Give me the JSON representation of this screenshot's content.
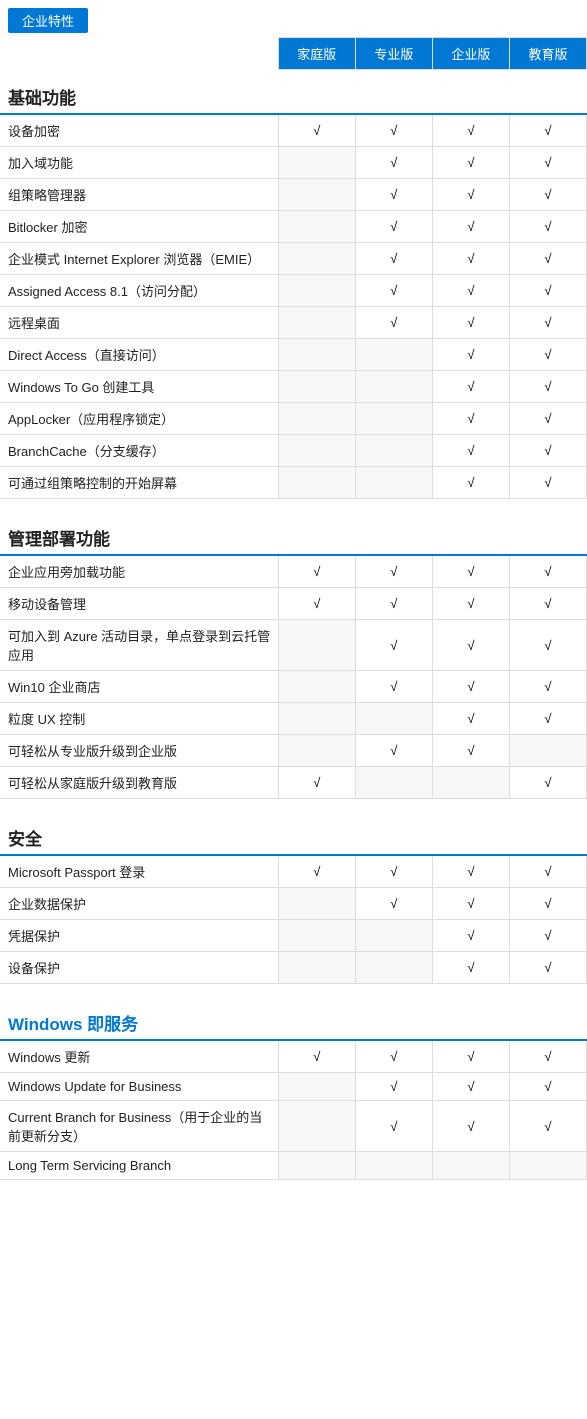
{
  "badge": "企业特性",
  "columns": [
    "家庭版",
    "专业版",
    "企业版",
    "教育版"
  ],
  "sections": [
    {
      "title": "基础功能",
      "blue": false,
      "rows": [
        {
          "name": "设备加密",
          "checks": [
            true,
            true,
            true,
            true
          ]
        },
        {
          "name": "加入域功能",
          "checks": [
            false,
            true,
            true,
            true
          ]
        },
        {
          "name": "组策略管理器",
          "checks": [
            false,
            true,
            true,
            true
          ]
        },
        {
          "name": "Bitlocker 加密",
          "checks": [
            false,
            true,
            true,
            true
          ]
        },
        {
          "name": "企业模式 Internet Explorer 浏览器（EMIE）",
          "checks": [
            false,
            true,
            true,
            true
          ]
        },
        {
          "name": "Assigned Access 8.1（访问分配）",
          "checks": [
            false,
            true,
            true,
            true
          ]
        },
        {
          "name": "远程桌面",
          "checks": [
            false,
            true,
            true,
            true
          ]
        },
        {
          "name": "Direct Access（直接访问）",
          "checks": [
            false,
            false,
            true,
            true
          ]
        },
        {
          "name": "Windows To Go 创建工具",
          "checks": [
            false,
            false,
            true,
            true
          ]
        },
        {
          "name": "AppLocker（应用程序锁定）",
          "checks": [
            false,
            false,
            true,
            true
          ]
        },
        {
          "name": "BranchCache（分支缓存）",
          "checks": [
            false,
            false,
            true,
            true
          ]
        },
        {
          "name": "可通过组策略控制的开始屏幕",
          "checks": [
            false,
            false,
            true,
            true
          ]
        }
      ]
    },
    {
      "title": "管理部署功能",
      "blue": false,
      "rows": [
        {
          "name": "企业应用旁加载功能",
          "checks": [
            true,
            true,
            true,
            true
          ]
        },
        {
          "name": "移动设备管理",
          "checks": [
            true,
            true,
            true,
            true
          ]
        },
        {
          "name": "可加入到 Azure 活动目录，单点登录到云托管应用",
          "checks": [
            false,
            true,
            true,
            true
          ]
        },
        {
          "name": "Win10 企业商店",
          "checks": [
            false,
            true,
            true,
            true
          ]
        },
        {
          "name": "粒度 UX 控制",
          "checks": [
            false,
            false,
            true,
            true
          ]
        },
        {
          "name": "可轻松从专业版升级到企业版",
          "checks": [
            false,
            true,
            true,
            false
          ]
        },
        {
          "name": "可轻松从家庭版升级到教育版",
          "checks": [
            true,
            false,
            false,
            true
          ]
        }
      ]
    },
    {
      "title": "安全",
      "blue": false,
      "rows": [
        {
          "name": "Microsoft Passport 登录",
          "checks": [
            true,
            true,
            true,
            true
          ]
        },
        {
          "name": "企业数据保护",
          "checks": [
            false,
            true,
            true,
            true
          ]
        },
        {
          "name": "凭据保护",
          "checks": [
            false,
            false,
            true,
            true
          ]
        },
        {
          "name": "设备保护",
          "checks": [
            false,
            false,
            true,
            true
          ]
        }
      ]
    },
    {
      "title": "Windows 即服务",
      "blue": true,
      "rows": [
        {
          "name": "Windows 更新",
          "checks": [
            true,
            true,
            true,
            true
          ]
        },
        {
          "name": "Windows Update for Business",
          "checks": [
            false,
            true,
            true,
            true
          ]
        },
        {
          "name": "Current Branch for Business（用于企业的当前更新分支）",
          "checks": [
            false,
            true,
            true,
            true
          ]
        },
        {
          "name": "Long Term Servicing Branch",
          "checks": [
            false,
            false,
            false,
            false
          ]
        }
      ]
    }
  ]
}
